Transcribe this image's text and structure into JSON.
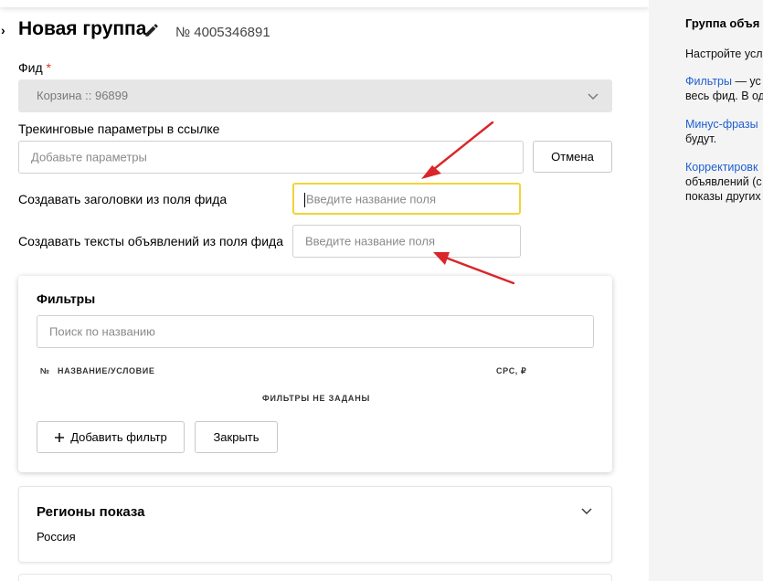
{
  "header": {
    "back_glyph": "›",
    "title": "Новая группа",
    "group_number": "№ 4005346891"
  },
  "form": {
    "feed_label": "Фид",
    "required_mark": "*",
    "feed_value": "Корзина :: 96899",
    "tracking_label": "Трекинговые параметры в ссылке",
    "tracking_placeholder": "Добавьте параметры",
    "cancel_label": "Отмена",
    "headlines_label": "Создавать заголовки из поля фида",
    "headlines_placeholder": "Введите название поля",
    "texts_label": "Создавать тексты объявлений из поля фида",
    "texts_placeholder": "Введите название поля"
  },
  "filters": {
    "title": "Фильтры",
    "search_placeholder": "Поиск по названию",
    "col_number": "№",
    "col_name": "НАЗВАНИЕ/УСЛОВИЕ",
    "col_cpc": "CPC, ₽",
    "empty_text": "ФИЛЬТРЫ НЕ ЗАДАНЫ",
    "add_filter_label": "Добавить фильтр",
    "close_label": "Закрыть"
  },
  "regions": {
    "title": "Регионы показа",
    "value": "Россия"
  },
  "sidebar": {
    "title": "Группа объя",
    "intro": "Настройте усл",
    "filters_link": "Фильтры",
    "filters_text_1": " — ус",
    "filters_text_2": "весь фид. В од",
    "minus_link": "Минус-фразы",
    "minus_text": "будут.",
    "adjust_link": "Корректировк",
    "adjust_text_1": "объявлений (с",
    "adjust_text_2": "показы других"
  },
  "colors": {
    "focus_border": "#f2d33a",
    "annotation_arrow": "#d9262a",
    "link": "#1f5fd1",
    "required": "#e0341e"
  }
}
